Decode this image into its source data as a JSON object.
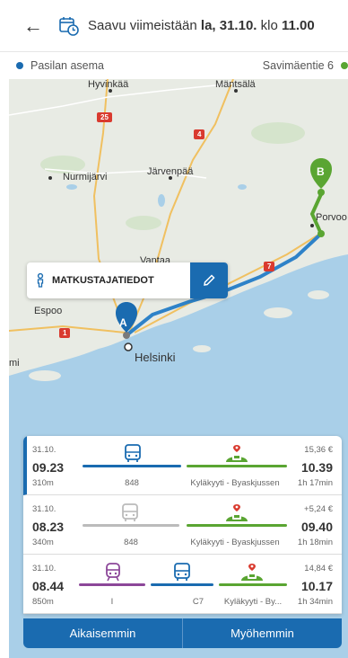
{
  "header": {
    "prefix": "Saavu viimeistään",
    "date": "la, 31.10.",
    "time_word": "klo",
    "time": "11.00",
    "back_icon": "arrow-left-icon",
    "calendar_icon": "calendar-clock-icon"
  },
  "route": {
    "from": "Pasilan asema",
    "to": "Savimäentie 6",
    "from_color": "#1a6bb0",
    "to_color": "#5aa532"
  },
  "map": {
    "places": [
      "Hyvinkää",
      "Mäntsälä",
      "Nurmijärvi",
      "Järvenpää",
      "Porvoo",
      "Espoo",
      "Helsinki",
      "mi",
      "Vantaa"
    ],
    "roads": [
      "25",
      "4",
      "7",
      "1"
    ],
    "markers": {
      "a": "A",
      "b": "B"
    }
  },
  "passenger": {
    "label": "MATKUSTAJATIEDOT",
    "icon": "person-icon",
    "edit_icon": "pencil-icon"
  },
  "results": [
    {
      "date": "31.10.",
      "depart": "09.23",
      "walk": "310m",
      "price": "15,36 €",
      "arrive": "10.39",
      "duration": "1h 17min",
      "seg1_label": "848",
      "seg2_label": "Kyläkyyti - Byaskjussen"
    },
    {
      "date": "31.10.",
      "depart": "08.23",
      "walk": "340m",
      "price": "+5,24 €",
      "arrive": "09.40",
      "duration": "1h 18min",
      "seg1_label": "848",
      "seg2_label": "Kyläkyyti - Byaskjussen"
    },
    {
      "date": "31.10.",
      "depart": "08.44",
      "walk": "850m",
      "price": "14,84 €",
      "arrive": "10.17",
      "duration": "1h 34min",
      "seg1_label": "I",
      "seg2_label": "C7",
      "seg3_label": "Kyläkyyti - By..."
    }
  ],
  "buttons": {
    "earlier": "Aikaisemmin",
    "later": "Myöhemmin"
  },
  "colors": {
    "bus": "#1a6bb0",
    "train": "#8c4799",
    "taxi": "#5aa532",
    "inactive": "#bbbbbb"
  }
}
